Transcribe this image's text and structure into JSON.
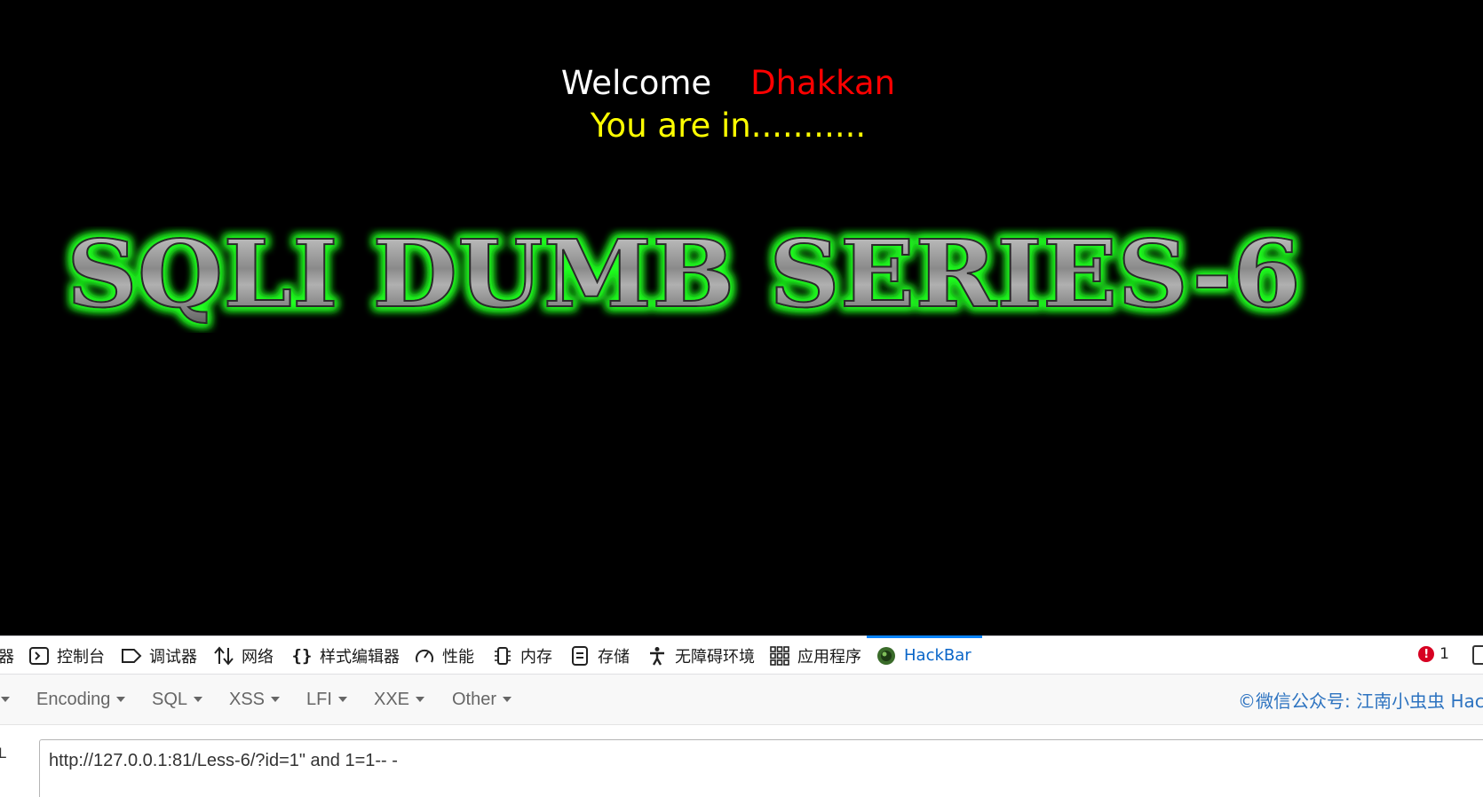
{
  "webpage": {
    "welcome_word": "Welcome",
    "welcome_name": "Dhakkan",
    "status": "You are in...........",
    "banner_title": "SQLI DUMB SERIES-6"
  },
  "devtools": {
    "tabs": [
      {
        "label": "器",
        "icon": "inspector-icon"
      },
      {
        "label": "控制台",
        "icon": "console-icon"
      },
      {
        "label": "调试器",
        "icon": "debugger-icon"
      },
      {
        "label": "网络",
        "icon": "network-icon"
      },
      {
        "label": "样式编辑器",
        "icon": "style-editor-icon"
      },
      {
        "label": "性能",
        "icon": "performance-icon"
      },
      {
        "label": "内存",
        "icon": "memory-icon"
      },
      {
        "label": "存储",
        "icon": "storage-icon"
      },
      {
        "label": "无障碍环境",
        "icon": "accessibility-icon"
      },
      {
        "label": "应用程序",
        "icon": "application-icon"
      },
      {
        "label": "HackBar",
        "icon": "hackbar-icon",
        "active": true
      }
    ],
    "error_count": "1",
    "active_color": "#0a84ff"
  },
  "hackbar": {
    "menu": [
      "Encoding",
      "SQL",
      "XSS",
      "LFI",
      "XXE",
      "Other"
    ],
    "credit": "©微信公众号: 江南小虫虫 Hac",
    "url_label": "L",
    "url_value": "http://127.0.0.1:81/Less-6/?id=1\" and 1=1-- -"
  },
  "colors": {
    "page_bg": "#000000",
    "welcome": "#ffffff",
    "name": "#ff0000",
    "status": "#ffff00",
    "title_glow": "#22ff22",
    "credit": "#2d73c0"
  }
}
